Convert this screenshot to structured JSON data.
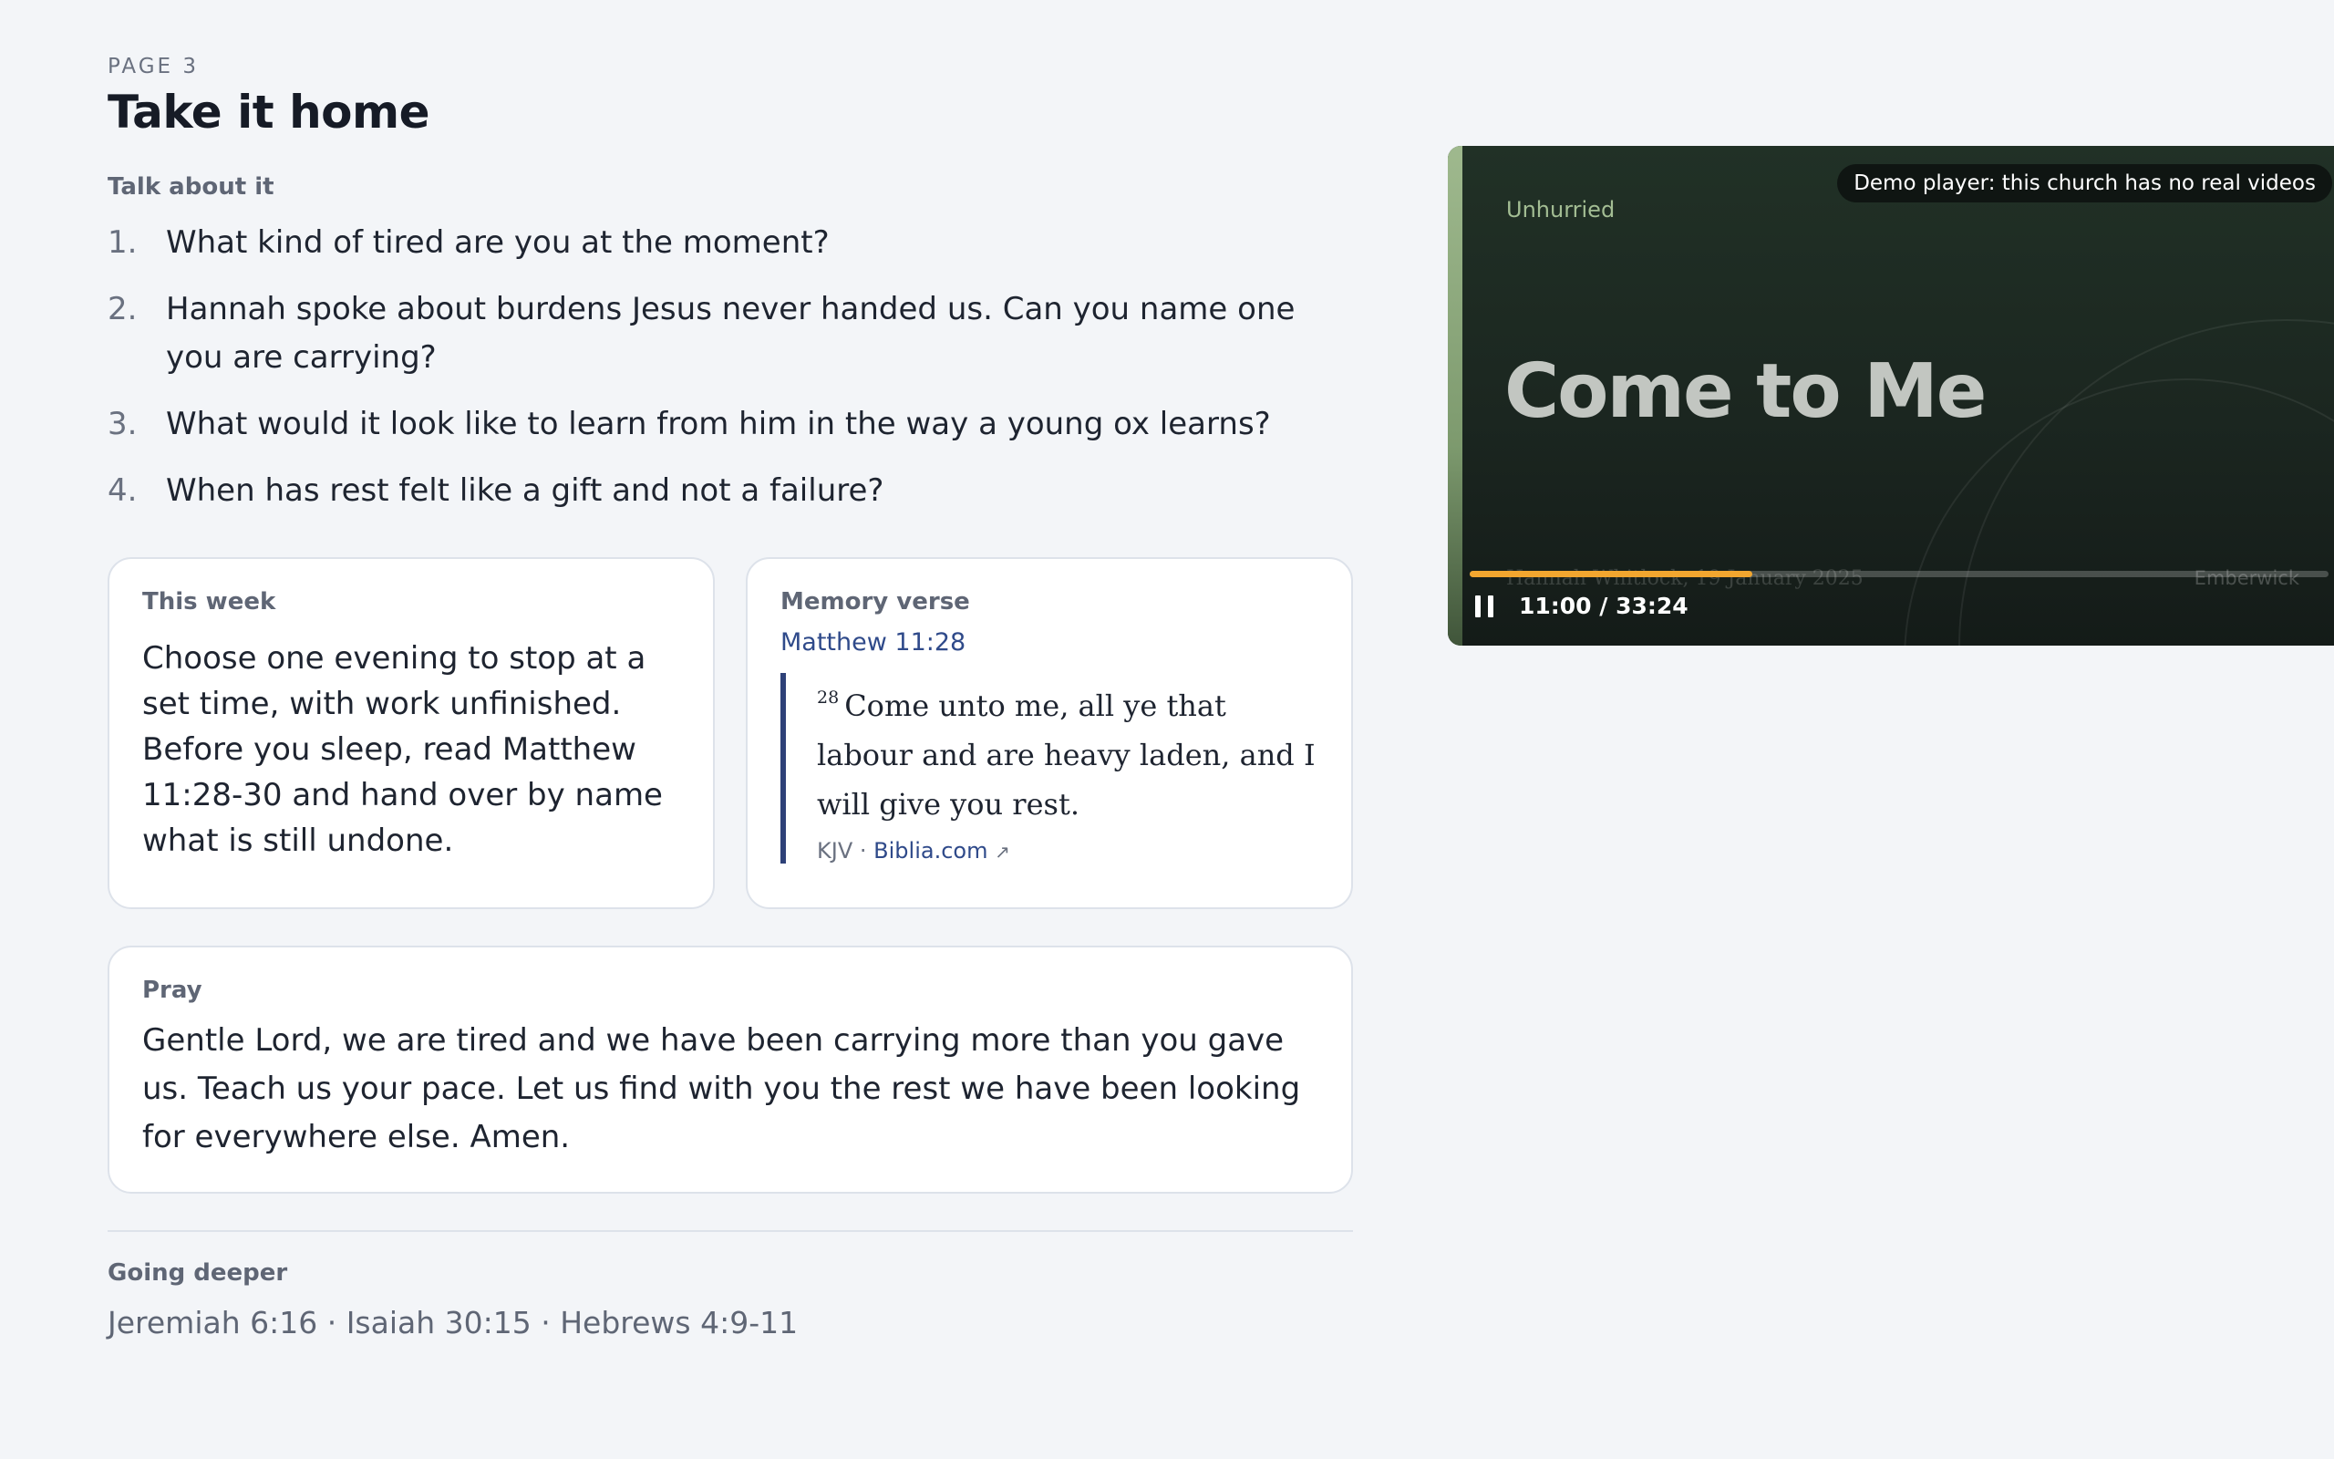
{
  "header": {
    "page_label": "PAGE 3",
    "title": "Take it home"
  },
  "discussion": {
    "label": "Talk about it",
    "questions": [
      {
        "num": "1.",
        "text": "What kind of tired are you at the moment?"
      },
      {
        "num": "2.",
        "text": "Hannah spoke about burdens Jesus never handed us. Can you name one you are carrying?"
      },
      {
        "num": "3.",
        "text": "What would it look like to learn from him in the way a young ox learns?"
      },
      {
        "num": "4.",
        "text": "When has rest felt like a gift and not a failure?"
      }
    ]
  },
  "this_week": {
    "label": "This week",
    "text": "Choose one evening to stop at a set time, with work unfinished. Before you sleep, read Matthew 11:28-30 and hand over by name what is still undone."
  },
  "memory_verse": {
    "label": "Memory verse",
    "reference": "Matthew 11:28",
    "verse_number": "28",
    "verse_text": "Come unto me, all ye that labour and are heavy laden, and I will give you rest.",
    "translation": "KJV",
    "separator": "·",
    "source_link": "Biblia.com",
    "external_icon": "↗"
  },
  "pray": {
    "label": "Pray",
    "text": "Gentle Lord, we are tired and we have been carrying more than you gave us. Teach us your pace. Let us find with you the rest we have been looking for everywhere else. Amen."
  },
  "going_deeper": {
    "label": "Going deeper",
    "references": "Jeremiah 6:16 · Isaiah 30:15 · Hebrews 4:9-11"
  },
  "player": {
    "demo_badge": "Demo player: this church has no real videos",
    "series": "Unhurried",
    "title": "Come to Me",
    "speaker_date": "Hannah Whitlock, 19 January 2025",
    "church": "Emberwick",
    "time": "11:00 / 33:24",
    "progress_fraction": 0.329,
    "state": "playing",
    "colors": {
      "accent": "#f2a62f",
      "series": "#a3bd93"
    }
  }
}
